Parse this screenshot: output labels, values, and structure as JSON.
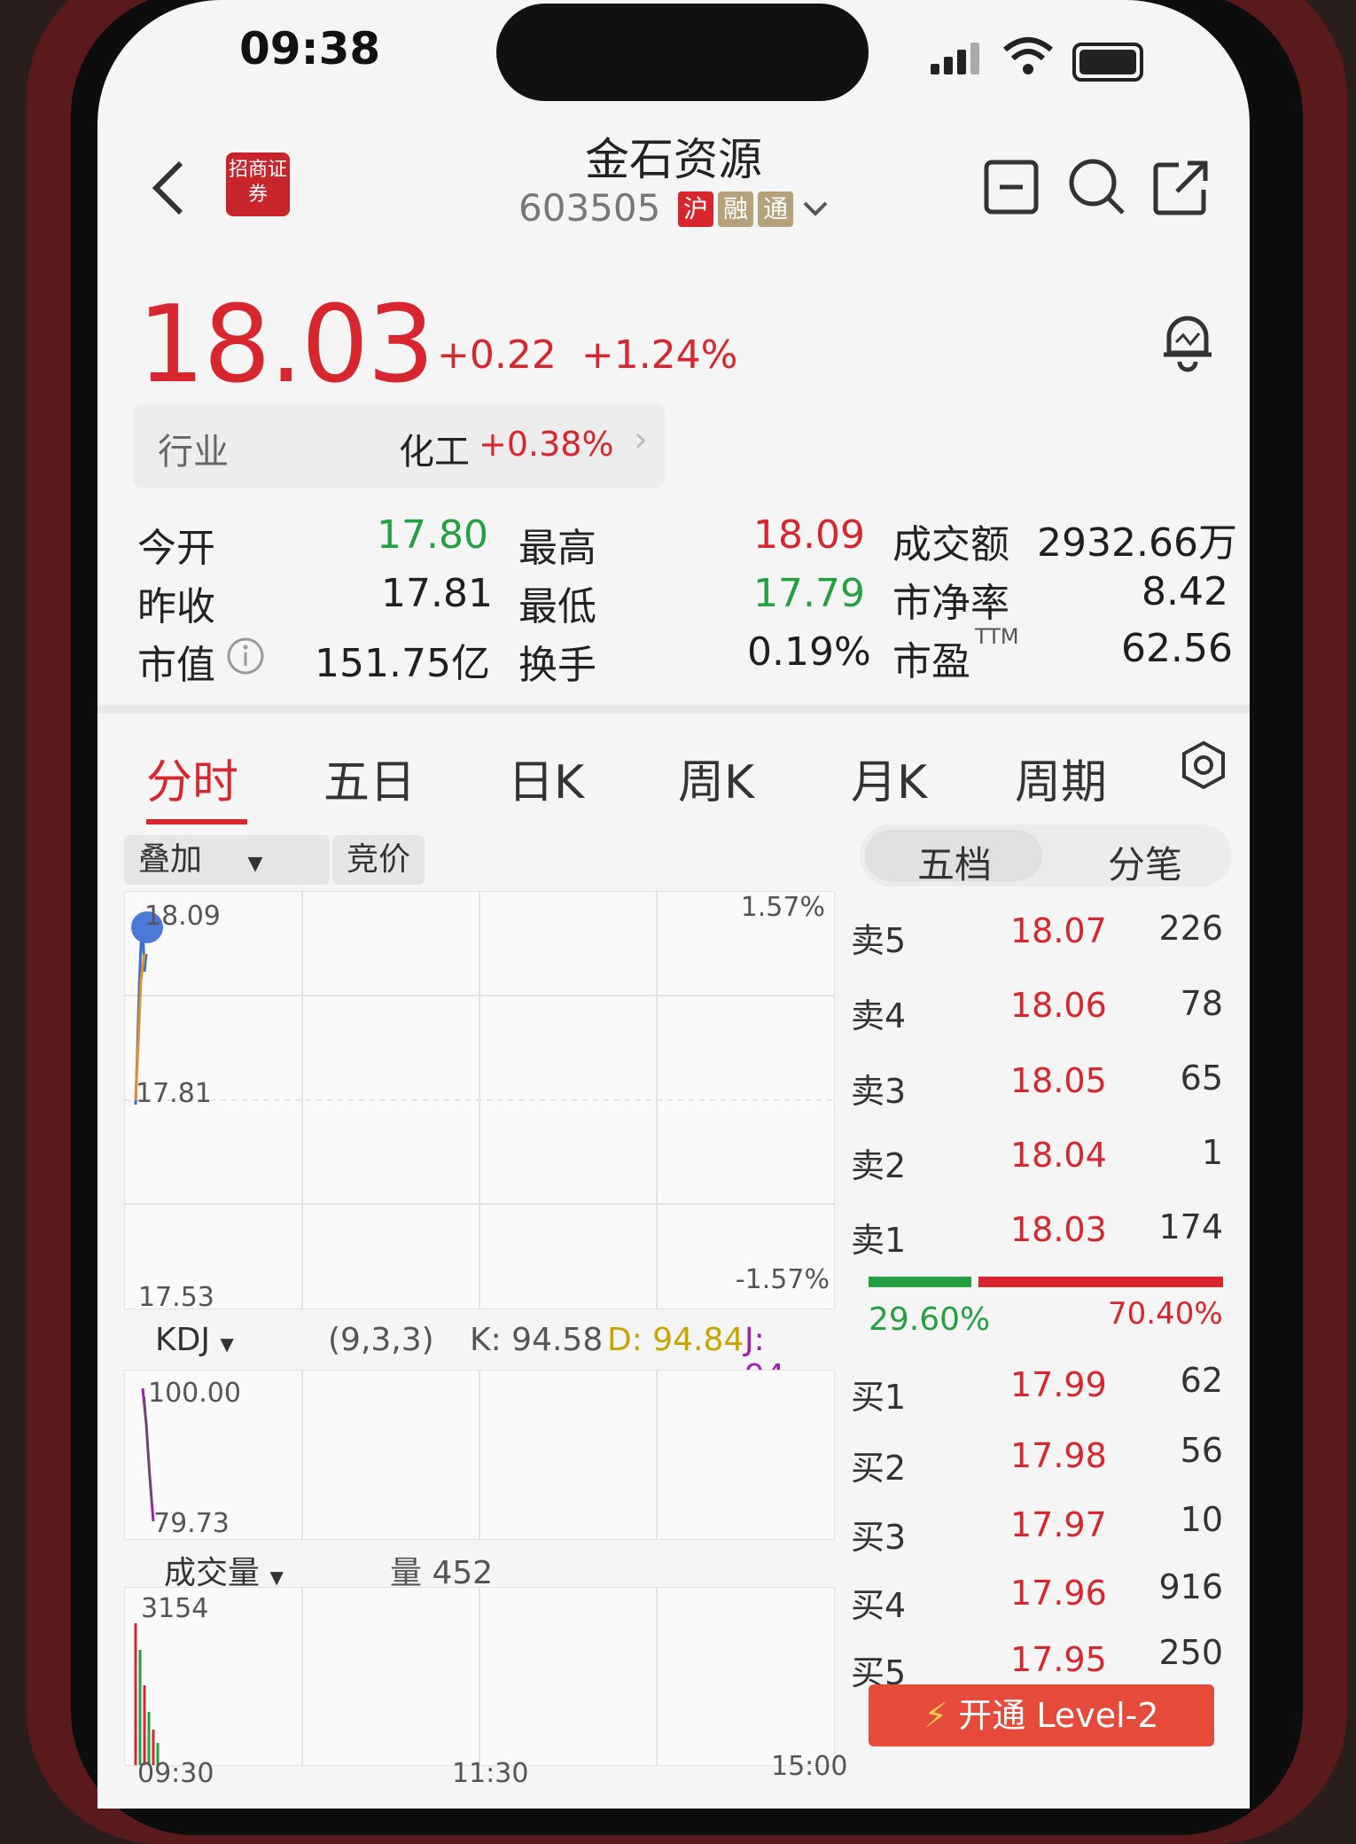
{
  "status_bar": {
    "time": "09:38"
  },
  "header": {
    "title": "金石资源",
    "code": "603505",
    "tags": [
      {
        "label": "沪",
        "color": "#d8262e"
      },
      {
        "label": "融",
        "color": "#b5a27a"
      },
      {
        "label": "通",
        "color": "#b5a27a"
      }
    ],
    "logo_text": "招商证券"
  },
  "quote": {
    "price": "18.03",
    "change": "+0.22",
    "change_pct": "+1.24%"
  },
  "industry": {
    "label": "行业",
    "name": "化工",
    "change": "+0.38%"
  },
  "stats": {
    "open_label": "今开",
    "open": "17.80",
    "high_label": "最高",
    "high": "18.09",
    "amount_label": "成交额",
    "amount": "2932.66万",
    "prev_close_label": "昨收",
    "prev_close": "17.81",
    "low_label": "最低",
    "low": "17.79",
    "pb_label": "市净率",
    "pb": "8.42",
    "mcap_label": "市值",
    "mcap": "151.75亿",
    "turnover_label": "换手",
    "turnover": "0.19%",
    "pe_label": "市盈",
    "pe_sup": "TTM",
    "pe": "62.56"
  },
  "tabs": [
    "分时",
    "五日",
    "日K",
    "周K",
    "月K",
    "周期"
  ],
  "active_tab": 0,
  "sub_buttons": {
    "overlay": "叠加",
    "auction": "竞价"
  },
  "order_book_tabs": [
    "五档",
    "分笔"
  ],
  "intraday_chart": {
    "y_top": "18.09",
    "y_mid": "17.81",
    "y_bottom": "17.53",
    "pct_top": "1.57%",
    "pct_bottom": "-1.57%"
  },
  "kdj": {
    "label": "KDJ",
    "params": "(9,3,3)",
    "k": "K: 94.58",
    "d": "D: 94.84",
    "j": "J: 94...",
    "y_top": "100.00",
    "y_bottom": "79.73"
  },
  "volume": {
    "label": "成交量",
    "value": "量 452",
    "y_top": "3154",
    "x_start": "09:30",
    "x_mid": "11:30",
    "x_end": "15:00"
  },
  "order_book": {
    "asks": [
      {
        "label": "卖5",
        "price": "18.07",
        "vol": "226"
      },
      {
        "label": "卖4",
        "price": "18.06",
        "vol": "78"
      },
      {
        "label": "卖3",
        "price": "18.05",
        "vol": "65"
      },
      {
        "label": "卖2",
        "price": "18.04",
        "vol": "1"
      },
      {
        "label": "卖1",
        "price": "18.03",
        "vol": "174"
      }
    ],
    "buy_pct": "29.60%",
    "sell_pct": "70.40%",
    "buy_ratio": 0.296,
    "bids": [
      {
        "label": "买1",
        "price": "17.99",
        "vol": "62"
      },
      {
        "label": "买2",
        "price": "17.98",
        "vol": "56"
      },
      {
        "label": "买3",
        "price": "17.97",
        "vol": "10"
      },
      {
        "label": "买4",
        "price": "17.96",
        "vol": "916"
      },
      {
        "label": "买5",
        "price": "17.95",
        "vol": "250"
      }
    ]
  },
  "level2_button": "开通 Level-2"
}
